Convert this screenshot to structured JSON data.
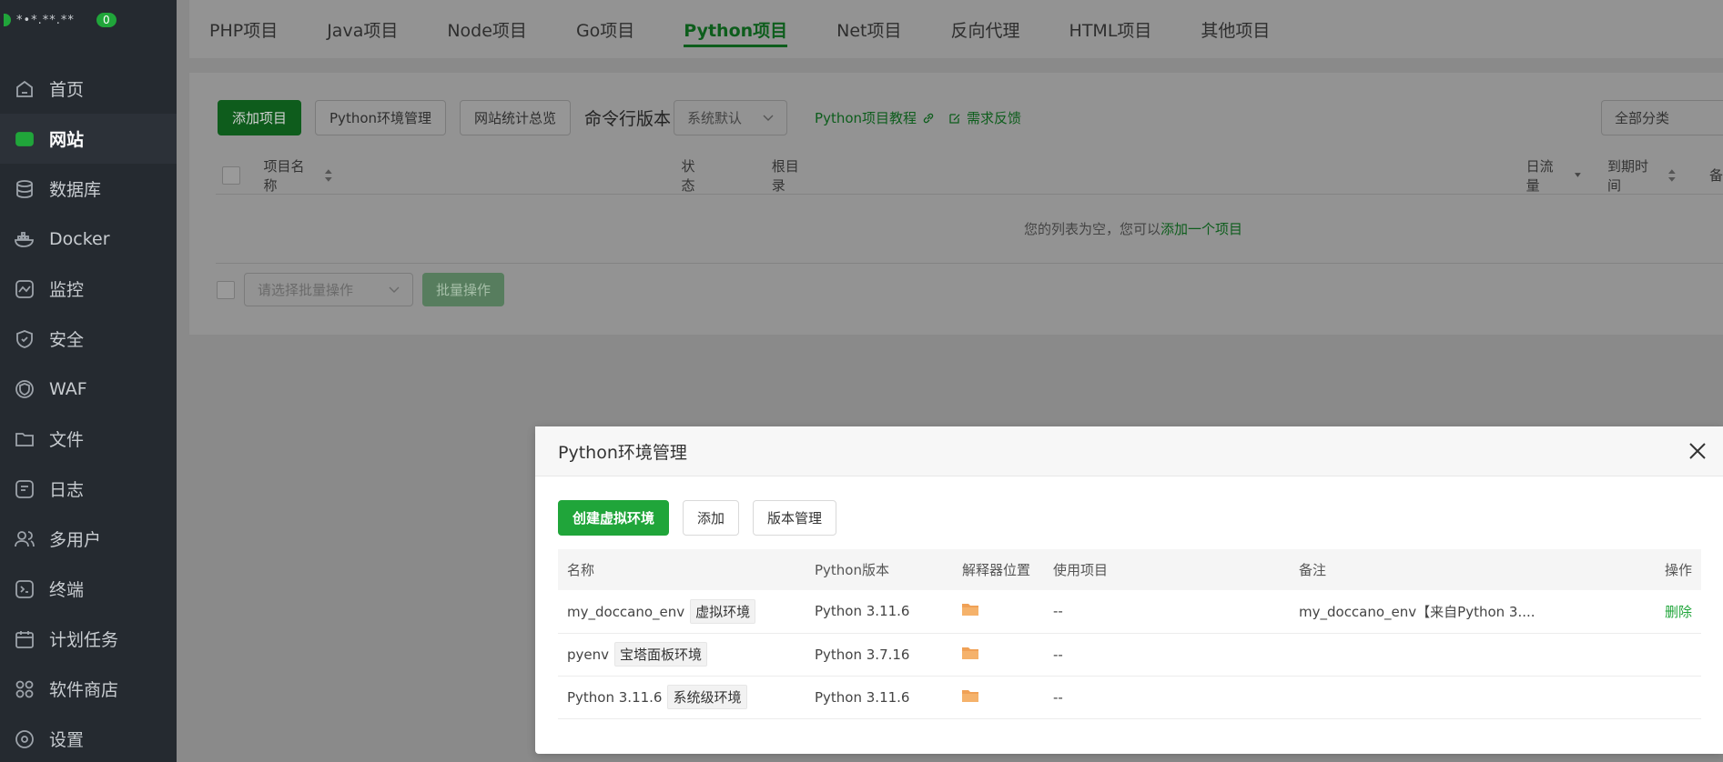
{
  "sidebar": {
    "host": "*•*.**.**",
    "badge": "0",
    "items": [
      {
        "label": "首页",
        "icon": "home-icon"
      },
      {
        "label": "网站",
        "icon": "website-icon",
        "active": true
      },
      {
        "label": "数据库",
        "icon": "database-icon"
      },
      {
        "label": "Docker",
        "icon": "docker-icon"
      },
      {
        "label": "监控",
        "icon": "monitor-icon"
      },
      {
        "label": "安全",
        "icon": "shield-icon"
      },
      {
        "label": "WAF",
        "icon": "waf-icon"
      },
      {
        "label": "文件",
        "icon": "folder-icon"
      },
      {
        "label": "日志",
        "icon": "log-icon"
      },
      {
        "label": "多用户",
        "icon": "users-icon"
      },
      {
        "label": "终端",
        "icon": "terminal-icon"
      },
      {
        "label": "计划任务",
        "icon": "calendar-icon"
      },
      {
        "label": "软件商店",
        "icon": "apps-icon"
      },
      {
        "label": "设置",
        "icon": "gear-icon"
      }
    ]
  },
  "tabs": [
    "PHP项目",
    "Java项目",
    "Node项目",
    "Go项目",
    "Python项目",
    "Net项目",
    "反向代理",
    "HTML项目",
    "其他项目"
  ],
  "active_tab": "Python项目",
  "toolbar": {
    "add_project": "添加项目",
    "env_manage": "Python环境管理",
    "site_stats": "网站统计总览",
    "cmd_version_label": "命令行版本",
    "cmd_version_value": "系统默认",
    "tutorial_link": "Python项目教程",
    "feedback_link": "需求反馈",
    "category_select": "全部分类"
  },
  "table": {
    "headers": {
      "name": "项目名称",
      "status": "状态",
      "root": "根目录",
      "traffic": "日流量",
      "expire": "到期时间",
      "note": "备"
    },
    "empty_prefix": "您的列表为空，您可以",
    "empty_link": "添加一个项目",
    "batch_placeholder": "请选择批量操作",
    "batch_button": "批量操作"
  },
  "modal": {
    "title": "Python环境管理",
    "create_env": "创建虚拟环境",
    "add": "添加",
    "version_manage": "版本管理",
    "columns": [
      "名称",
      "Python版本",
      "解释器位置",
      "使用项目",
      "备注",
      "操作"
    ],
    "rows": [
      {
        "name": "my_doccano_env",
        "tag": "虚拟环境",
        "version": "Python 3.11.6",
        "used": "--",
        "note": "my_doccano_env【来自Python 3....",
        "action": "删除"
      },
      {
        "name": "pyenv",
        "tag": "宝塔面板环境",
        "version": "Python 3.7.16",
        "used": "--",
        "note": "",
        "action": ""
      },
      {
        "name": "Python 3.11.6",
        "tag": "系统级环境",
        "version": "Python 3.11.6",
        "used": "--",
        "note": "",
        "action": ""
      }
    ]
  },
  "colors": {
    "brand": "#20a53a",
    "sidebar_bg": "#252a30",
    "overlay": "#8a8a8a"
  }
}
